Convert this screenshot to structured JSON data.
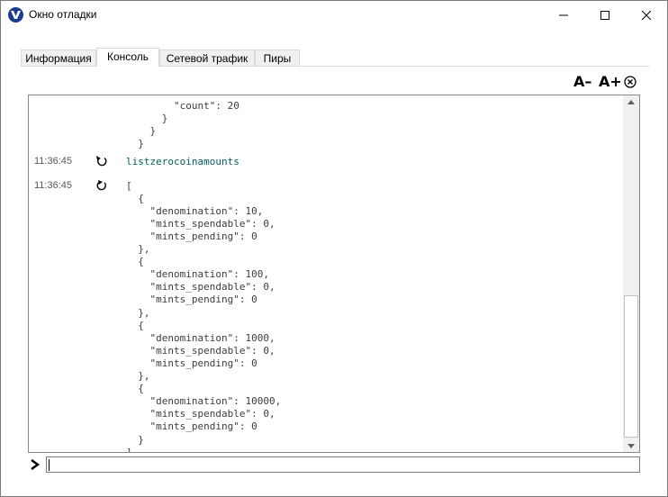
{
  "window": {
    "title": "Окно отладки",
    "icon": "app-logo-icon"
  },
  "tabs": [
    {
      "label": "Информация",
      "active": false
    },
    {
      "label": "Консоль",
      "active": true
    },
    {
      "label": "Сетевой трафик",
      "active": false
    },
    {
      "label": "Пиры",
      "active": false
    }
  ],
  "toolbar": {
    "font_smaller_label": "A–",
    "font_larger_label": "A+",
    "clear_icon": "clear-circle-x-icon"
  },
  "console": {
    "lines": [
      {
        "time": "",
        "icon": "",
        "text": "        \"count\": 20"
      },
      {
        "time": "",
        "icon": "",
        "text": "      }"
      },
      {
        "time": "",
        "icon": "",
        "text": "    }"
      },
      {
        "time": "",
        "icon": "",
        "text": "  }"
      },
      {
        "time": "11:36:45",
        "icon": "request-icon",
        "text": "listzerocoinamounts"
      },
      {
        "time": "11:36:45",
        "icon": "reply-icon",
        "text": "["
      },
      {
        "time": "",
        "icon": "",
        "text": "  {"
      },
      {
        "time": "",
        "icon": "",
        "text": "    \"denomination\": 10,"
      },
      {
        "time": "",
        "icon": "",
        "text": "    \"mints_spendable\": 0,"
      },
      {
        "time": "",
        "icon": "",
        "text": "    \"mints_pending\": 0"
      },
      {
        "time": "",
        "icon": "",
        "text": "  },"
      },
      {
        "time": "",
        "icon": "",
        "text": "  {"
      },
      {
        "time": "",
        "icon": "",
        "text": "    \"denomination\": 100,"
      },
      {
        "time": "",
        "icon": "",
        "text": "    \"mints_spendable\": 0,"
      },
      {
        "time": "",
        "icon": "",
        "text": "    \"mints_pending\": 0"
      },
      {
        "time": "",
        "icon": "",
        "text": "  },"
      },
      {
        "time": "",
        "icon": "",
        "text": "  {"
      },
      {
        "time": "",
        "icon": "",
        "text": "    \"denomination\": 1000,"
      },
      {
        "time": "",
        "icon": "",
        "text": "    \"mints_spendable\": 0,"
      },
      {
        "time": "",
        "icon": "",
        "text": "    \"mints_pending\": 0"
      },
      {
        "time": "",
        "icon": "",
        "text": "  },"
      },
      {
        "time": "",
        "icon": "",
        "text": "  {"
      },
      {
        "time": "",
        "icon": "",
        "text": "    \"denomination\": 10000,"
      },
      {
        "time": "",
        "icon": "",
        "text": "    \"mints_spendable\": 0,"
      },
      {
        "time": "",
        "icon": "",
        "text": "    \"mints_pending\": 0"
      },
      {
        "time": "",
        "icon": "",
        "text": "  }"
      },
      {
        "time": "",
        "icon": "",
        "text": "]"
      }
    ]
  },
  "input": {
    "value": "",
    "placeholder": ""
  },
  "colors": {
    "command": "#006060",
    "app_icon": "#1a3d8f"
  }
}
